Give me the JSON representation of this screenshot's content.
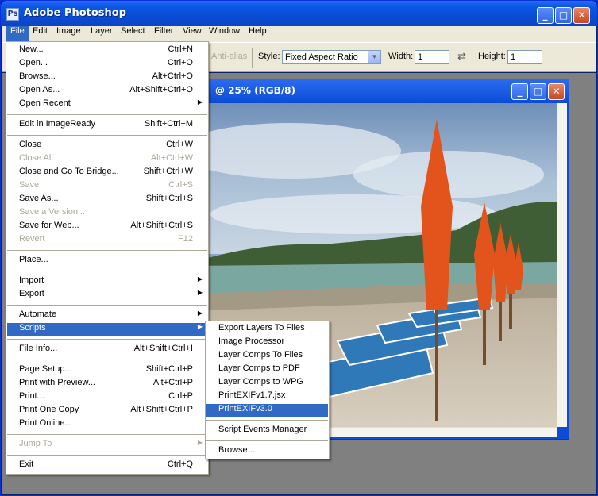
{
  "app": {
    "title": "Adobe Photoshop",
    "icon": "photoshop-icon"
  },
  "window_controls": {
    "minimize": "minimize-icon",
    "maximize": "maximize-icon",
    "close": "close-icon"
  },
  "menubar": [
    "File",
    "Edit",
    "Image",
    "Layer",
    "Select",
    "Filter",
    "View",
    "Window",
    "Help"
  ],
  "options": {
    "antialias": "Anti-alias",
    "style_label": "Style:",
    "style_value": "Fixed Aspect Ratio",
    "width_label": "Width:",
    "width_value": "1",
    "height_label": "Height:",
    "height_value": "1",
    "swap_icon": "swap-arrows-icon"
  },
  "document": {
    "title": "@ 25% (RGB/8)"
  },
  "file_menu": [
    {
      "label": "New...",
      "shortcut": "Ctrl+N"
    },
    {
      "label": "Open...",
      "shortcut": "Ctrl+O"
    },
    {
      "label": "Browse...",
      "shortcut": "Alt+Ctrl+O"
    },
    {
      "label": "Open As...",
      "shortcut": "Alt+Shift+Ctrl+O"
    },
    {
      "label": "Open Recent",
      "submenu": true
    },
    {
      "sep": true
    },
    {
      "label": "Edit in ImageReady",
      "shortcut": "Shift+Ctrl+M"
    },
    {
      "sep": true
    },
    {
      "label": "Close",
      "shortcut": "Ctrl+W"
    },
    {
      "label": "Close All",
      "shortcut": "Alt+Ctrl+W",
      "disabled": true
    },
    {
      "label": "Close and Go To Bridge...",
      "shortcut": "Shift+Ctrl+W"
    },
    {
      "label": "Save",
      "shortcut": "Ctrl+S",
      "disabled": true
    },
    {
      "label": "Save As...",
      "shortcut": "Shift+Ctrl+S"
    },
    {
      "label": "Save a Version...",
      "disabled": true
    },
    {
      "label": "Save for Web...",
      "shortcut": "Alt+Shift+Ctrl+S"
    },
    {
      "label": "Revert",
      "shortcut": "F12",
      "disabled": true
    },
    {
      "sep": true
    },
    {
      "label": "Place..."
    },
    {
      "sep": true
    },
    {
      "label": "Import",
      "submenu": true
    },
    {
      "label": "Export",
      "submenu": true
    },
    {
      "sep": true
    },
    {
      "label": "Automate",
      "submenu": true
    },
    {
      "label": "Scripts",
      "submenu": true,
      "highlighted": true
    },
    {
      "sep": true
    },
    {
      "label": "File Info...",
      "shortcut": "Alt+Shift+Ctrl+I"
    },
    {
      "sep": true
    },
    {
      "label": "Page Setup...",
      "shortcut": "Shift+Ctrl+P"
    },
    {
      "label": "Print with Preview...",
      "shortcut": "Alt+Ctrl+P"
    },
    {
      "label": "Print...",
      "shortcut": "Ctrl+P"
    },
    {
      "label": "Print One Copy",
      "shortcut": "Alt+Shift+Ctrl+P"
    },
    {
      "label": "Print Online..."
    },
    {
      "sep": true
    },
    {
      "label": "Jump To",
      "submenu": true,
      "disabled": true
    },
    {
      "sep": true
    },
    {
      "label": "Exit",
      "shortcut": "Ctrl+Q"
    }
  ],
  "scripts_menu": [
    {
      "label": "Export Layers To Files"
    },
    {
      "label": "Image Processor"
    },
    {
      "label": "Layer Comps To Files"
    },
    {
      "label": "Layer Comps to PDF"
    },
    {
      "label": "Layer Comps to WPG"
    },
    {
      "label": "PrintEXIFv1.7.jsx"
    },
    {
      "label": "PrintEXIFv3.0",
      "highlighted": true
    },
    {
      "sep": true
    },
    {
      "label": "Script Events Manager"
    },
    {
      "sep": true
    },
    {
      "label": "Browse..."
    }
  ]
}
